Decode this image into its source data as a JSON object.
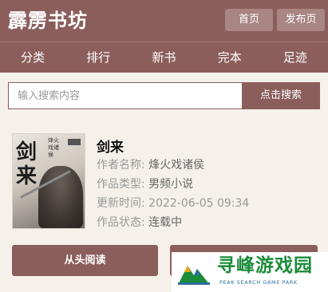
{
  "header": {
    "logo": "霹雳书坊",
    "home_label": "首页",
    "publish_label": "发布页"
  },
  "nav": {
    "items": [
      {
        "label": "分类"
      },
      {
        "label": "排行"
      },
      {
        "label": "新书"
      },
      {
        "label": "完本"
      },
      {
        "label": "足迹"
      }
    ]
  },
  "search": {
    "placeholder": "输入搜索内容",
    "value": "",
    "button_label": "点击搜索"
  },
  "book": {
    "cover_title": "剑来",
    "cover_sub": "烽火戏诸侯",
    "title": "剑来",
    "author_label": "作者名称:",
    "author": "烽火戏诸侯",
    "type_label": "作品类型:",
    "type": "男频小说",
    "updated_label": "更新时间:",
    "updated": "2022-06-05 09:34",
    "status_label": "作品状态:",
    "status": "连载中"
  },
  "actions": {
    "read_label": "从头阅读"
  },
  "watermark": {
    "text": "寻峰游戏园",
    "sub": "PEAK SEARCH GAME PARK"
  },
  "colors": {
    "primary": "#8b5e5c",
    "button_light": "#a98583",
    "background": "#f5f1ea",
    "watermark_green": "#1b8c3a"
  }
}
